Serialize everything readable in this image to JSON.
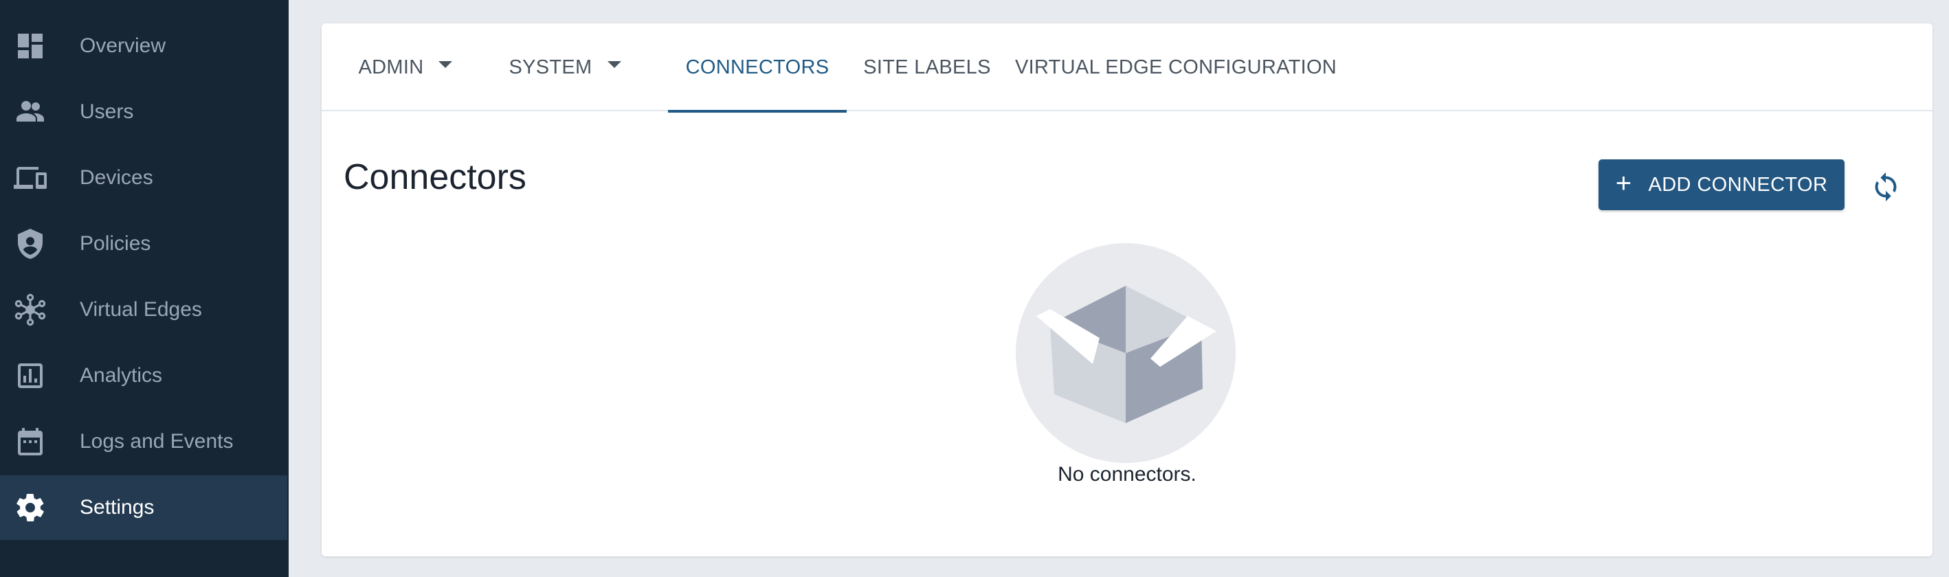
{
  "sidebar": {
    "items": [
      {
        "label": "Overview",
        "icon": "dashboard-icon",
        "active": false
      },
      {
        "label": "Users",
        "icon": "users-icon",
        "active": false
      },
      {
        "label": "Devices",
        "icon": "devices-icon",
        "active": false
      },
      {
        "label": "Policies",
        "icon": "shield-icon",
        "active": false
      },
      {
        "label": "Virtual Edges",
        "icon": "network-icon",
        "active": false
      },
      {
        "label": "Analytics",
        "icon": "analytics-icon",
        "active": false
      },
      {
        "label": "Logs and Events",
        "icon": "calendar-icon",
        "active": false
      },
      {
        "label": "Settings",
        "icon": "gear-icon",
        "active": true
      }
    ]
  },
  "tabs": [
    {
      "label": "ADMIN",
      "dropdown": true,
      "active": false
    },
    {
      "label": "SYSTEM",
      "dropdown": true,
      "active": false
    },
    {
      "label": "CONNECTORS",
      "dropdown": false,
      "active": true
    },
    {
      "label": "SITE LABELS",
      "dropdown": false,
      "active": false
    },
    {
      "label": "VIRTUAL EDGE CONFIGURATION",
      "dropdown": false,
      "active": false
    }
  ],
  "main": {
    "title": "Connectors",
    "add_button_label": "ADD CONNECTOR",
    "empty_message": "No connectors."
  },
  "colors": {
    "sidebar_bg": "#162634",
    "sidebar_active_bg": "#233a51",
    "accent": "#1f5a86",
    "button_bg": "#235681"
  }
}
